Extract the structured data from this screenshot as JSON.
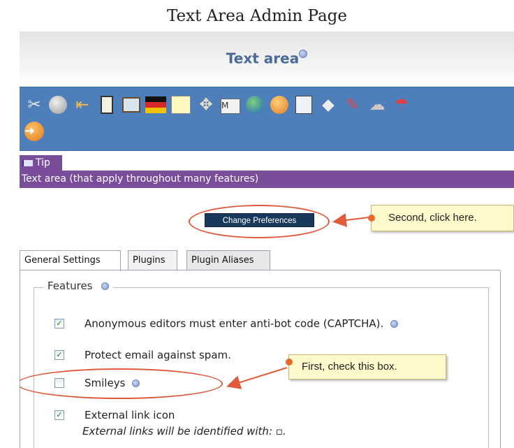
{
  "caption": "Text Area Admin Page",
  "header": {
    "title": "Text area"
  },
  "toolbar": {
    "icons": [
      "tools-icon",
      "power-icon",
      "exit-door-icon",
      "hourglass-icon",
      "image-frame-icon",
      "german-flag-icon",
      "notepad-icon",
      "puzzle-icon",
      "email-icon",
      "globe-icon",
      "users-icon",
      "calendar-icon",
      "card-stack-icon",
      "plug-icon",
      "brain-icon",
      "debug-icon",
      "forward-arrow-icon"
    ]
  },
  "tip": {
    "label": "Tip",
    "text": "Text area (that apply throughout many features)"
  },
  "buttons": {
    "change_preferences": "Change Preferences"
  },
  "callouts": {
    "second": "Second, click here.",
    "first": "First, check this box."
  },
  "tabs": [
    "General Settings",
    "Plugins",
    "Plugin Aliases"
  ],
  "features": {
    "legend": "Features",
    "options": [
      {
        "label": "Anonymous editors must enter anti-bot code (CAPTCHA).",
        "checked": true,
        "help": true
      },
      {
        "label": "Protect email against spam.",
        "checked": true,
        "help": false
      },
      {
        "label": "Smileys",
        "checked": false,
        "help": true
      },
      {
        "label": "External link icon",
        "checked": true,
        "help": false,
        "note": "External links will be identified with: ▫."
      }
    ]
  },
  "colors": {
    "toolbar": "#4f7fba",
    "tip": "#7a4d9a",
    "title": "#4b6a98",
    "highlight": "#e05a3c"
  }
}
